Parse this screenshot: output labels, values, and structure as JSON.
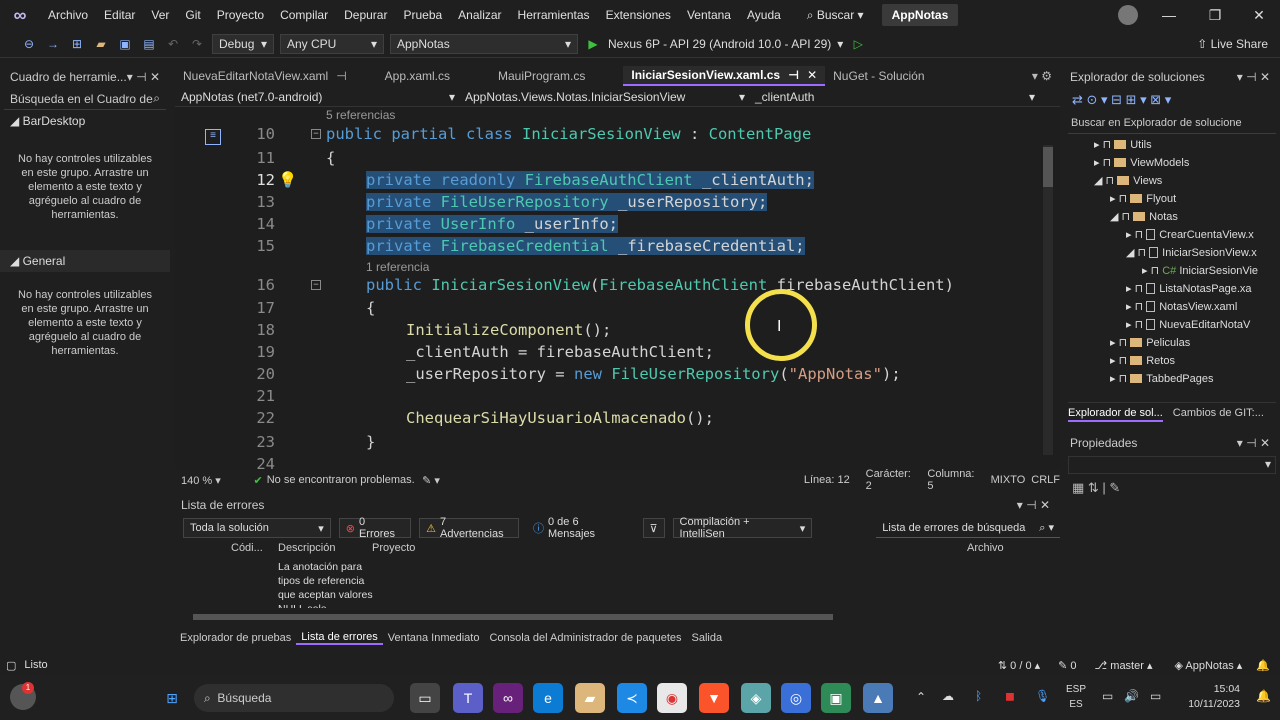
{
  "menubar": {
    "items": [
      "Archivo",
      "Editar",
      "Ver",
      "Git",
      "Proyecto",
      "Compilar",
      "Depurar",
      "Prueba",
      "Analizar",
      "Herramientas",
      "Extensiones",
      "Ventana",
      "Ayuda"
    ],
    "search": "Buscar",
    "project": "AppNotas"
  },
  "toolbar": {
    "config": "Debug",
    "platform": "Any CPU",
    "startup": "AppNotas",
    "run_target": "Nexus 6P - API 29 (Android 10.0 - API 29)",
    "live_share": "Live Share"
  },
  "toolbox": {
    "title": "Cuadro de herramie...",
    "search": "Búsqueda en el Cuadro de",
    "groups": [
      {
        "name": "BarDesktop",
        "empty": "No hay controles utilizables en este grupo. Arrastre un elemento a este texto y agréguelo al cuadro de herramientas."
      },
      {
        "name": "General",
        "empty": "No hay controles utilizables en este grupo. Arrastre un elemento a este texto y agréguelo al cuadro de herramientas."
      }
    ]
  },
  "editor": {
    "tabs": [
      "NuevaEditarNotaView.xaml",
      "App.xaml.cs",
      "MauiProgram.cs",
      "IniciarSesionView.xaml.cs",
      "NuGet - Solución"
    ],
    "active_tab": "IniciarSesionView.xaml.cs",
    "nav_project": "AppNotas (net7.0-android)",
    "nav_class": "AppNotas.Views.Notas.IniciarSesionView",
    "nav_member": "_clientAuth",
    "refs_5": "5 referencias",
    "refs_1": "1 referencia",
    "line_numbers": [
      "10",
      "11",
      "12",
      "13",
      "14",
      "15",
      "16",
      "17",
      "18",
      "19",
      "20",
      "21",
      "22",
      "23",
      "24"
    ]
  },
  "editor_status": {
    "zoom": "140 %",
    "issues": "No se encontraron problemas.",
    "line": "Línea: 12",
    "char": "Carácter: 2",
    "column": "Columna: 5",
    "tabs": "MIXTO",
    "eol": "CRLF"
  },
  "errorlist": {
    "title": "Lista de errores",
    "scope": "Toda la solución",
    "errors": "0 Errores",
    "warnings": "7 Advertencias",
    "messages": "0 de 6 Mensajes",
    "build": "Compilación + IntelliSen",
    "search": "Lista de errores de búsqueda",
    "columns": [
      "Códi...",
      "Descripción",
      "Proyecto",
      "Archivo"
    ],
    "row_description": "La anotación para tipos de referencia que aceptan valores NULL solo"
  },
  "bottom_tabs": [
    "Explorador de pruebas",
    "Lista de errores",
    "Ventana Inmediato",
    "Consola del Administrador de paquetes",
    "Salida"
  ],
  "solution_explorer": {
    "title": "Explorador de soluciones",
    "search": "Buscar en Explorador de solucione",
    "items": [
      "Utils",
      "ViewModels",
      "Views",
      "Flyout",
      "Notas",
      "CrearCuentaView.x",
      "IniciarSesionView.x",
      "IniciarSesionVie",
      "ListaNotasPage.xa",
      "NotasView.xaml",
      "NuevaEditarNotaV",
      "Peliculas",
      "Retos",
      "TabbedPages"
    ],
    "tabs": [
      "Explorador de sol...",
      "Cambios de GIT:..."
    ]
  },
  "properties": {
    "title": "Propiedades"
  },
  "statusbar": {
    "ready": "Listo",
    "sync": "0 / 0",
    "pending": "0",
    "branch": "master",
    "repo": "AppNotas"
  },
  "taskbar": {
    "search": "Búsqueda",
    "lang1": "ESP",
    "lang2": "ES",
    "time": "15:04",
    "date": "10/11/2023",
    "notification_badge": "1"
  }
}
